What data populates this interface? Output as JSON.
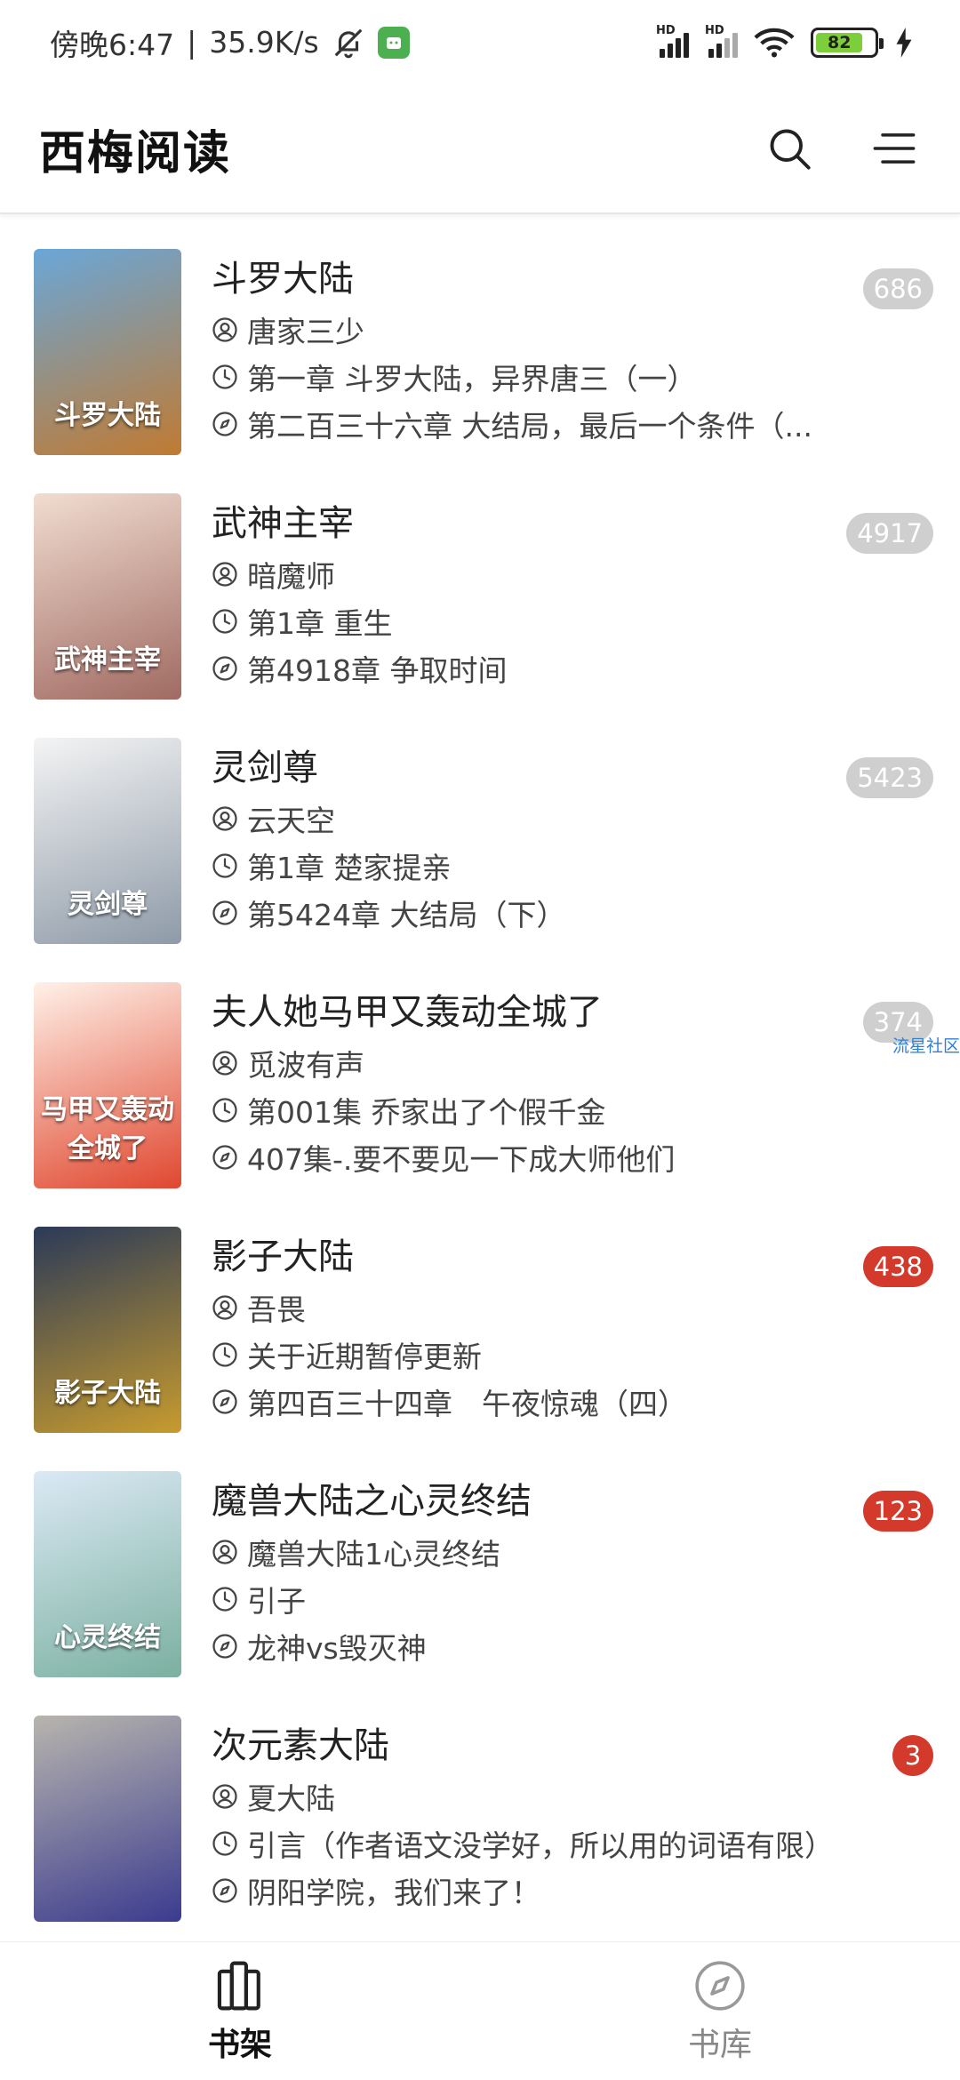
{
  "status_bar": {
    "time": "傍晚6:47",
    "separator": "|",
    "net_speed": "35.9K/s",
    "battery": "82",
    "signal_label_1": "HD",
    "signal_label_2": "HD"
  },
  "app_bar": {
    "title": "西梅阅读"
  },
  "books": [
    {
      "title": "斗罗大陆",
      "author": "唐家三少",
      "read_chapter": "第一章 斗罗大陆，异界唐三（一）",
      "latest_chapter": "第二百三十六章 大结局，最后一个条件（...",
      "badge": "686",
      "badge_color": "#cfcfcf",
      "cover_text": "斗罗大陆",
      "cover_colors": [
        "#6aa7d8",
        "#c07a32"
      ]
    },
    {
      "title": "武神主宰",
      "author": "暗魔师",
      "read_chapter": "第1章 重生",
      "latest_chapter": "第4918章 争取时间",
      "badge": "4917",
      "badge_color": "#cfcfcf",
      "cover_text": "武神主宰",
      "cover_colors": [
        "#f1ddd0",
        "#a06a62"
      ]
    },
    {
      "title": "灵剑尊",
      "author": "云天空",
      "read_chapter": "第1章 楚家提亲",
      "latest_chapter": "第5424章 大结局（下）",
      "badge": "5423",
      "badge_color": "#cfcfcf",
      "cover_text": "灵剑尊",
      "cover_colors": [
        "#f4f4f4",
        "#8e9aa8"
      ]
    },
    {
      "title": "夫人她马甲又轰动全城了",
      "author": "觅波有声",
      "read_chapter": "第001集 乔家出了个假千金",
      "latest_chapter": "407集-.要不要见一下成大师他们",
      "badge": "374",
      "badge_color": "#cfcfcf",
      "cover_text": "马甲又轰动全城了",
      "cover_colors": [
        "#fff1e8",
        "#e0472f"
      ]
    },
    {
      "title": "影子大陆",
      "author": "吾畏",
      "read_chapter": "关于近期暂停更新",
      "latest_chapter": "第四百三十四章　午夜惊魂（四）",
      "badge": "438",
      "badge_color": "#d33a2c",
      "cover_text": "影子大陆",
      "cover_colors": [
        "#2b3a58",
        "#c79b2e"
      ]
    },
    {
      "title": "魔兽大陆之心灵终结",
      "author": "魔兽大陆1心灵终结",
      "read_chapter": "引子",
      "latest_chapter": "龙神vs毁灭神",
      "badge": "123",
      "badge_color": "#d33a2c",
      "cover_text": "心灵终结",
      "cover_colors": [
        "#dbe9f5",
        "#7bb0a0"
      ]
    },
    {
      "title": "次元素大陆",
      "author": "夏大陆",
      "read_chapter": "引言（作者语文没学好，所以用的词语有限）",
      "latest_chapter": "阴阳学院，我们来了！",
      "badge": "3",
      "badge_color": "#d33a2c",
      "cover_text": "",
      "cover_colors": [
        "#b8b5ae",
        "#3b3b8f"
      ]
    }
  ],
  "watermark": "流星社区",
  "bottom_nav": {
    "shelf_label": "书架",
    "library_label": "书库"
  },
  "colors": {
    "accent_red": "#d33a2c",
    "badge_grey": "#cfcfcf"
  }
}
